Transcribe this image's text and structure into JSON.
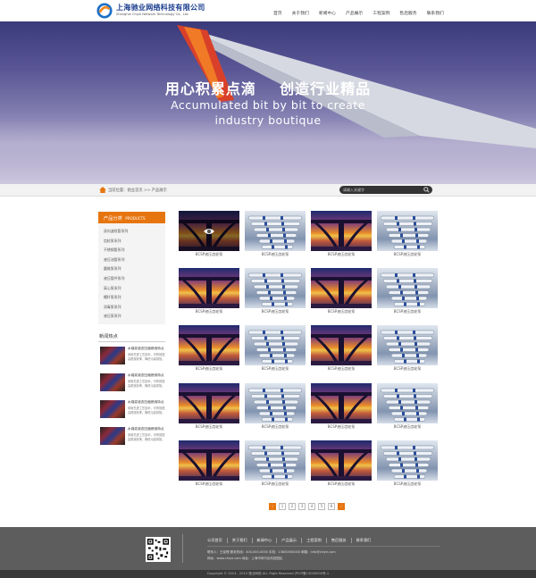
{
  "header": {
    "company_cn": "上海驰业网络科技有限公司",
    "company_en": "Shanghai Chiye Network Technology Co., Ltd.",
    "nav": [
      "首页",
      "关于我们",
      "新闻中心",
      "产品展示",
      "工程案例",
      "售后服务",
      "联系我们"
    ]
  },
  "banner": {
    "slogan_cn": "用心积累点滴    创造行业精品",
    "slogan_en_line1": "Accumulated bit by bit to create",
    "slogan_en_line2": "industry boutique"
  },
  "breadcrumb": {
    "text": "当前位置：驰业首页 >> 产品展示",
    "search_placeholder": "请输入关键字"
  },
  "sidebar": {
    "category_title": "产品分类",
    "category_title_en": "PRODUCTS",
    "categories": [
      "双向波纹管系列",
      "齿轮泵系列",
      "不锈钢管系列",
      "液压油管系列",
      "圆锥泵系列",
      "液压管件系列",
      "离心泵系列",
      "螺杆泵系列",
      "消毒泵系列",
      "液压泵系列"
    ],
    "news_title": "新闻热点",
    "news": [
      {
        "title": "水煤浆液态压缩燃烧特点",
        "desc": "采用先进工艺技术，可有效提高燃烧效率，降低污染排放。"
      },
      {
        "title": "水煤浆液态压缩燃烧特点",
        "desc": "采用先进工艺技术，可有效提高燃烧效率，降低污染排放。"
      },
      {
        "title": "水煤浆液态压缩燃烧特点",
        "desc": "采用先进工艺技术，可有效提高燃烧效率，降低污染排放。"
      },
      {
        "title": "水煤浆液态压缩燃烧特点",
        "desc": "采用先进工艺技术，可有效提高燃烧效率，降低污染排放。"
      }
    ]
  },
  "products": {
    "caption": "BCSP液压齿轮泵",
    "images": [
      "pier",
      "pipe",
      "pier",
      "pipe",
      "pier",
      "pipe",
      "pier",
      "pipe",
      "pier",
      "pipe",
      "pier",
      "pipe",
      "pier",
      "pipe",
      "pier",
      "pipe",
      "pier",
      "pipe",
      "pier",
      "pipe"
    ]
  },
  "pager": {
    "prev": "‹",
    "pages": [
      "1",
      "2",
      "3",
      "4",
      "5",
      "6"
    ],
    "next": "›"
  },
  "footer": {
    "nav": [
      "公司首页",
      "关于我们",
      "新闻中心",
      "产品展示",
      "工程案例",
      "售后服务",
      "联系我们"
    ],
    "info_line1": "联系人：王经理    服务热线：400-000-0000    手机：13800000000    邮箱：info@chiye.com",
    "info_line2": "网址：www.chiye.com    地址：上海市闵行区科技园区",
    "copyright": "Copyright © 2014 - 2015 驰业网络 ALL Right Reserved    沪ICP备13000000号-1"
  },
  "colors": {
    "accent": "#e7750f",
    "brand": "#1a3d8f",
    "footer": "#5d5d5d"
  }
}
